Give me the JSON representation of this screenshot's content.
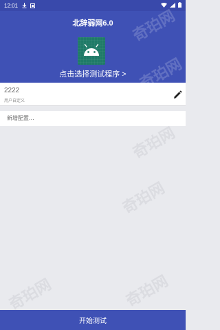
{
  "status_bar": {
    "time": "12:01",
    "icons": [
      "download-icon",
      "notification-icon",
      "wifi-icon",
      "signal-icon",
      "battery-icon"
    ]
  },
  "header": {
    "title": "北辞弱网6.0",
    "select_program": "点击选择测试程序 >",
    "background": "#3f51b5",
    "status_bar_color": "#3949ab"
  },
  "config": {
    "name": "2222",
    "type": "用户自定义"
  },
  "add_config": {
    "label": "新增配置..."
  },
  "bottom": {
    "start_label": "开始测试"
  },
  "watermark": {
    "text": "奇珀网"
  }
}
